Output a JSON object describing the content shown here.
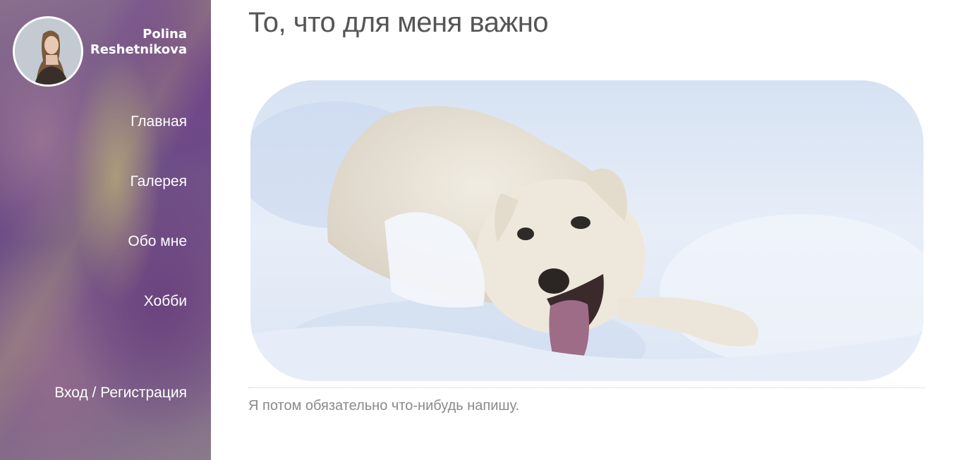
{
  "sidebar": {
    "user": {
      "first_name": "Polina",
      "last_name": "Reshetnikova"
    },
    "nav": [
      {
        "label": "Главная"
      },
      {
        "label": "Галерея"
      },
      {
        "label": "Обо мне"
      },
      {
        "label": "Хобби"
      },
      {
        "label": "Вход / Регистрация"
      }
    ]
  },
  "main": {
    "title": "То, что для меня важно",
    "caption": "Я потом обязательно что-нибудь напишу."
  },
  "colors": {
    "title_text": "#555555",
    "caption_text": "#8a8a8a",
    "sidebar_accent": "#6d4d86"
  }
}
